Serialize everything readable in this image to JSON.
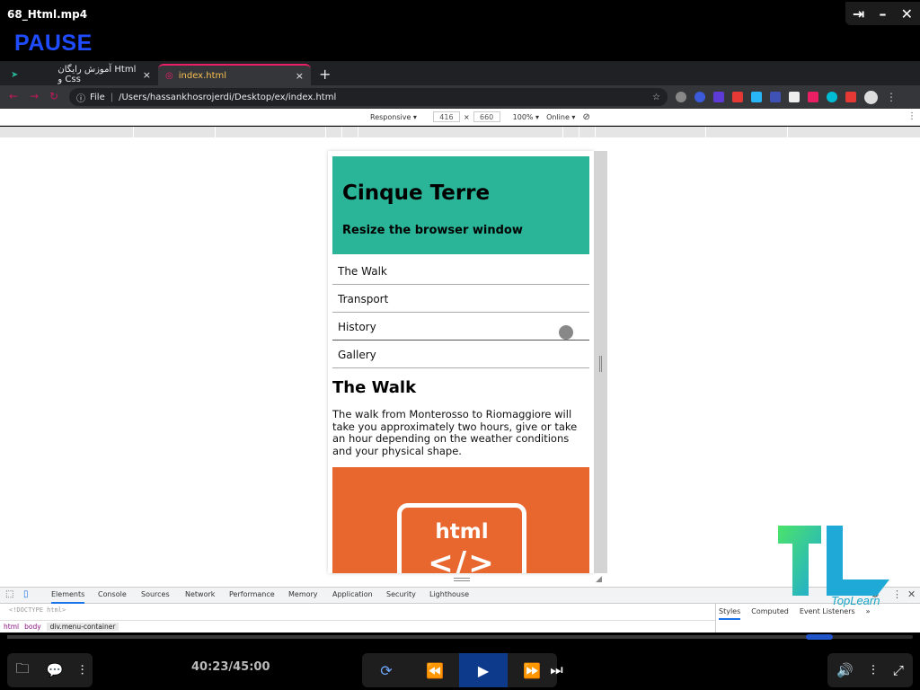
{
  "player": {
    "file_title": "68_Html.mp4",
    "state_label": "PAUSE",
    "time": "40:23/45:00",
    "progress_fraction": 0.897
  },
  "browser": {
    "tabs": [
      {
        "label": "آموزش رایگان Html و Css",
        "close": "×"
      },
      {
        "label": "index.html",
        "close": "×"
      }
    ],
    "new_tab": "+",
    "omnibox": {
      "scheme": "File",
      "url": "/Users/hassankhosrojerdi/Desktop/ex/index.html"
    }
  },
  "device_toolbar": {
    "mode": "Responsive ▾",
    "width": "416",
    "times": "×",
    "height": "660",
    "zoom": "100% ▾",
    "network": "Online ▾"
  },
  "page": {
    "title": "Cinque Terre",
    "subtitle": "Resize the browser window",
    "menu": [
      "The Walk",
      "Transport",
      "History",
      "Gallery"
    ],
    "section_heading": "The Walk",
    "section_text": "The walk from Monterosso to Riomaggiore will take you approximately two hours, give or take an hour depending on the weather conditions and your physical shape.",
    "image_word": "html",
    "image_tag": "</>"
  },
  "devtools": {
    "tabs": [
      "Elements",
      "Console",
      "Sources",
      "Network",
      "Performance",
      "Memory",
      "Application",
      "Security",
      "Lighthouse"
    ],
    "doctype": "<!DOCTYPE html>",
    "breadcrumbs": [
      "html",
      "body",
      "div.menu-container"
    ],
    "styles_tabs": [
      "Styles",
      "Computed",
      "Event Listeners",
      "»"
    ]
  },
  "logo_text": "TopLearn",
  "colors": {
    "hero": "#2ab598",
    "image_bg": "#e8672f",
    "pause": "#1f4cff",
    "play_btn": "#0e3a8c"
  }
}
